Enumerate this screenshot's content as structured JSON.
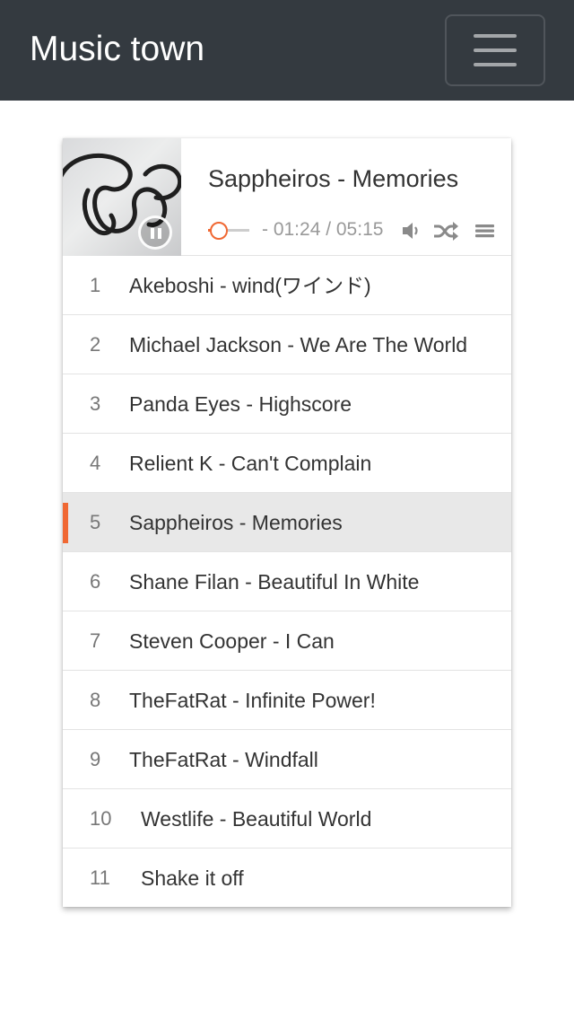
{
  "navbar": {
    "brand": "Music town",
    "toggle_icon": "hamburger-menu-icon"
  },
  "player": {
    "now_playing": "Sappheiros - Memories",
    "time_display": "- 01:24 / 05:15",
    "progress_fraction": 0.27,
    "state": "playing",
    "accent_color": "#f06833",
    "icons": [
      "pause-icon",
      "volume-icon",
      "shuffle-icon",
      "playlist-menu-icon"
    ]
  },
  "playlist": [
    {
      "num": "1",
      "name": "Akeboshi - wind(ワインド)"
    },
    {
      "num": "2",
      "name": "Michael Jackson - We Are The World"
    },
    {
      "num": "3",
      "name": "Panda Eyes - Highscore"
    },
    {
      "num": "4",
      "name": "Relient K - Can't Complain"
    },
    {
      "num": "5",
      "name": "Sappheiros - Memories"
    },
    {
      "num": "6",
      "name": "Shane Filan - Beautiful In White"
    },
    {
      "num": "7",
      "name": "Steven Cooper - I Can"
    },
    {
      "num": "8",
      "name": "TheFatRat - Infinite Power!"
    },
    {
      "num": "9",
      "name": "TheFatRat - Windfall"
    },
    {
      "num": "10",
      "name": "Westlife - Beautiful World"
    },
    {
      "num": "11",
      "name": "Shake it off"
    }
  ],
  "active_index": 4
}
